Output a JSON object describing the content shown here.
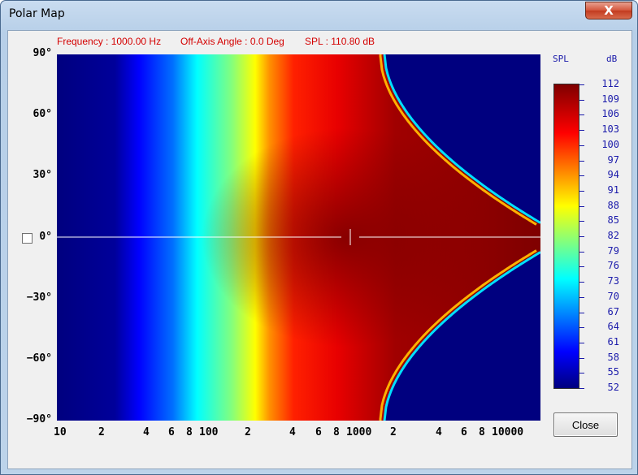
{
  "window": {
    "title": "Polar Map",
    "close_glyph": "X"
  },
  "readouts": {
    "frequency": "Frequency : 1000.00 Hz",
    "angle": "Off-Axis Angle : 0.0 Deg",
    "spl": "SPL : 110.80 dB"
  },
  "y_axis": {
    "ticks": [
      "90°",
      "60°",
      "30°",
      "0°",
      "−30°",
      "−60°",
      "−90°"
    ]
  },
  "x_axis": {
    "ticks": [
      "10",
      "2",
      "4",
      "6",
      "8",
      "100",
      "2",
      "4",
      "6",
      "8",
      "1000",
      "2",
      "4",
      "6",
      "8",
      "10000"
    ]
  },
  "colorbar": {
    "header_left": "SPL",
    "header_right": "dB",
    "labels": [
      "112",
      "109",
      "106",
      "103",
      "100",
      "97",
      "94",
      "91",
      "88",
      "85",
      "82",
      "79",
      "76",
      "73",
      "70",
      "67",
      "64",
      "61",
      "58",
      "55",
      "52"
    ]
  },
  "buttons": {
    "close": "Close"
  },
  "chart_data": {
    "type": "heatmap",
    "x_scale": "log",
    "xlim": [
      10,
      20000
    ],
    "ylim": [
      -90,
      90
    ],
    "value_range": [
      52,
      112
    ],
    "value_unit": "dB",
    "cursor": {
      "frequency_hz": 1000,
      "angle_deg": 0,
      "spl_db": 110.8
    },
    "colormap": "jet",
    "colors": [
      "#00007f",
      "#0000ff",
      "#0080ff",
      "#00ffff",
      "#80ff80",
      "#ffff00",
      "#ff8000",
      "#ff0000",
      "#7f0000"
    ]
  }
}
